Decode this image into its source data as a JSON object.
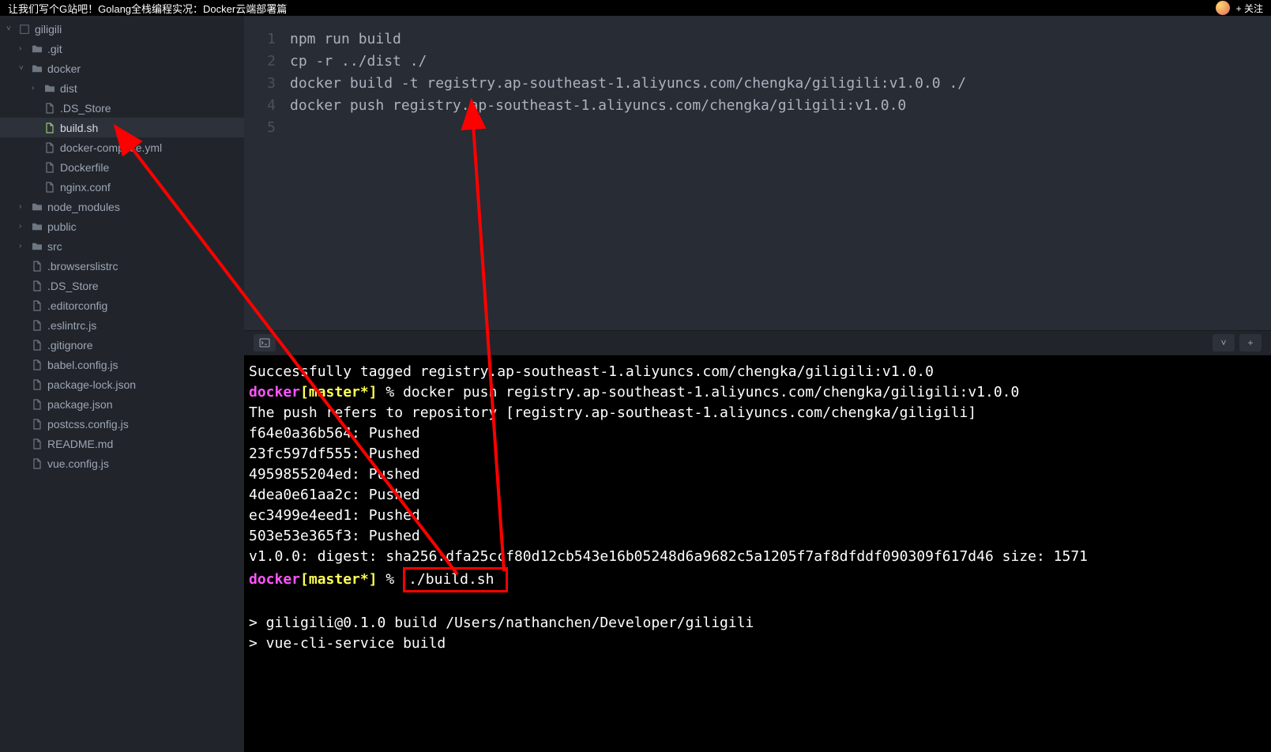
{
  "topbar": {
    "title": "让我们写个G站吧！Golang全栈编程实况：Docker云端部署篇",
    "follow": "+ 关注"
  },
  "sidebar": {
    "root": "giligili",
    "items": [
      {
        "type": "folder",
        "name": ".git",
        "indent": 1,
        "chev": "›"
      },
      {
        "type": "folder-open",
        "name": "docker",
        "indent": 1,
        "chev": "˅"
      },
      {
        "type": "folder",
        "name": "dist",
        "indent": 2,
        "chev": "›"
      },
      {
        "type": "file",
        "name": ".DS_Store",
        "indent": 2
      },
      {
        "type": "file-active",
        "name": "build.sh",
        "indent": 2
      },
      {
        "type": "file",
        "name": "docker-compose.yml",
        "indent": 2
      },
      {
        "type": "file",
        "name": "Dockerfile",
        "indent": 2
      },
      {
        "type": "file",
        "name": "nginx.conf",
        "indent": 2
      },
      {
        "type": "folder",
        "name": "node_modules",
        "indent": 1,
        "chev": "›"
      },
      {
        "type": "folder",
        "name": "public",
        "indent": 1,
        "chev": "›"
      },
      {
        "type": "folder",
        "name": "src",
        "indent": 1,
        "chev": "›"
      },
      {
        "type": "file",
        "name": ".browserslistrc",
        "indent": 1
      },
      {
        "type": "file",
        "name": ".DS_Store",
        "indent": 1
      },
      {
        "type": "file",
        "name": ".editorconfig",
        "indent": 1
      },
      {
        "type": "file",
        "name": ".eslintrc.js",
        "indent": 1
      },
      {
        "type": "file",
        "name": ".gitignore",
        "indent": 1
      },
      {
        "type": "file",
        "name": "babel.config.js",
        "indent": 1
      },
      {
        "type": "file",
        "name": "package-lock.json",
        "indent": 1
      },
      {
        "type": "file",
        "name": "package.json",
        "indent": 1
      },
      {
        "type": "file",
        "name": "postcss.config.js",
        "indent": 1
      },
      {
        "type": "file",
        "name": "README.md",
        "indent": 1
      },
      {
        "type": "file",
        "name": "vue.config.js",
        "indent": 1
      }
    ]
  },
  "editor": {
    "lines": [
      {
        "n": "1",
        "text": "npm run build"
      },
      {
        "n": "2",
        "text": "cp -r ../dist ./"
      },
      {
        "n": "3",
        "text": "docker build -t registry.ap-southeast-1.aliyuncs.com/chengka/giligili:v1.0.0 ./"
      },
      {
        "n": "4",
        "text": "docker push registry.ap-southeast-1.aliyuncs.com/chengka/giligili:v1.0.0"
      },
      {
        "n": "5",
        "text": ""
      }
    ]
  },
  "terminal": {
    "lines": [
      {
        "t": "plain",
        "text": "Successfully tagged registry.ap-southeast-1.aliyuncs.com/chengka/giligili:v1.0.0"
      },
      {
        "t": "prompt",
        "dir": "docker",
        "branch": "[master*]",
        "sym": " % ",
        "cmd": "docker push registry.ap-southeast-1.aliyuncs.com/chengka/giligili:v1.0.0"
      },
      {
        "t": "plain",
        "text": "The push refers to repository [registry.ap-southeast-1.aliyuncs.com/chengka/giligili]"
      },
      {
        "t": "plain",
        "text": "f64e0a36b564: Pushed"
      },
      {
        "t": "plain",
        "text": "23fc597df555: Pushed"
      },
      {
        "t": "plain",
        "text": "4959855204ed: Pushed"
      },
      {
        "t": "plain",
        "text": "4dea0e61aa2c: Pushed"
      },
      {
        "t": "plain",
        "text": "ec3499e4eed1: Pushed"
      },
      {
        "t": "plain",
        "text": "503e53e365f3: Pushed"
      },
      {
        "t": "plain",
        "text": "v1.0.0: digest: sha256:dfa25ccf80d12cb543e16b05248d6a9682c5a1205f7af8dfddf090309f617d46 size: 1571"
      },
      {
        "t": "prompt-boxed",
        "dir": "docker",
        "branch": "[master*]",
        "sym": " % ",
        "cmd": "./build.sh "
      },
      {
        "t": "blank",
        "text": ""
      },
      {
        "t": "plain",
        "text": "> giligili@0.1.0 build /Users/nathanchen/Developer/giligili"
      },
      {
        "t": "plain",
        "text": "> vue-cli-service build"
      }
    ]
  }
}
